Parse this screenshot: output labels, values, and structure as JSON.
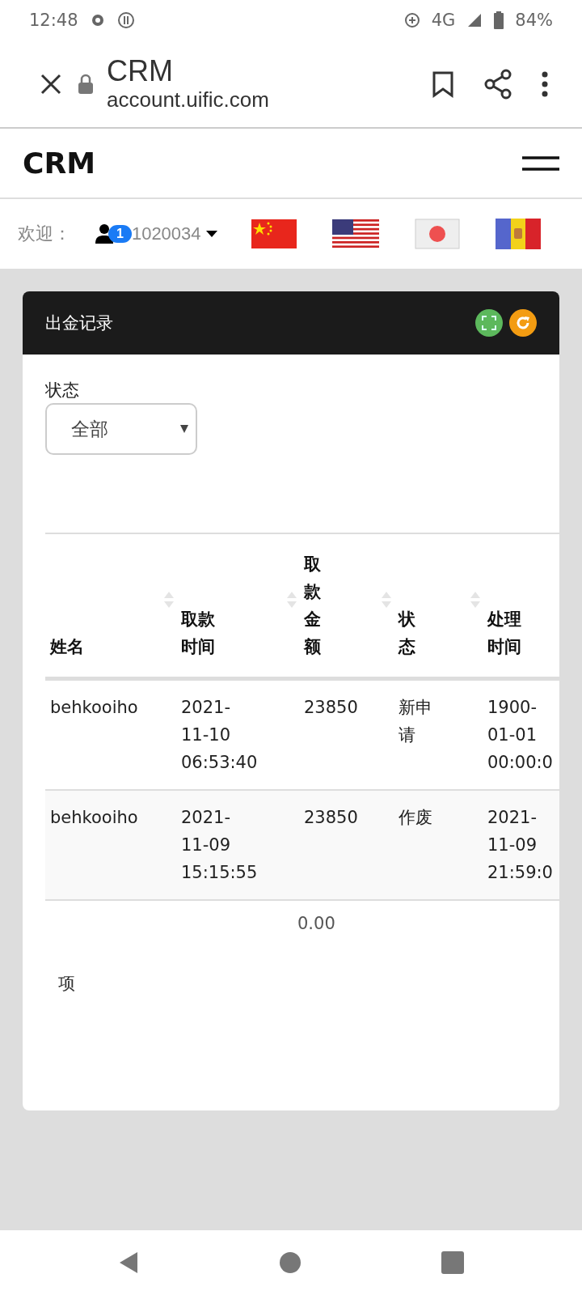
{
  "status_bar": {
    "time": "12:48",
    "network": "4G",
    "battery": "84%"
  },
  "browser": {
    "title": "CRM",
    "url": "account.uific.com"
  },
  "navbar": {
    "brand": "CRM"
  },
  "welcome": {
    "label": "欢迎：",
    "badge": "1",
    "user": "1020034"
  },
  "panel": {
    "title": "出金记录",
    "filter": {
      "label": "状态",
      "value": "全部"
    },
    "table": {
      "columns": [
        {
          "label": "姓名",
          "sortable": true
        },
        {
          "label": "取款时间",
          "sortable": true
        },
        {
          "label": "取款金额",
          "sortable": true
        },
        {
          "label": "状态",
          "sortable": true
        },
        {
          "label": "处理时间"
        }
      ],
      "rows": [
        [
          "behkooiho",
          "2021-\n11-10\n06:53:40",
          "23850",
          "新申请",
          "1900-\n01-01\n00:00:0"
        ],
        [
          "behkooiho",
          "2021-\n11-09\n15:15:55",
          "23850",
          "作废",
          "2021-\n11-09\n21:59:0"
        ]
      ],
      "total": "0.00"
    },
    "footer": "项"
  }
}
